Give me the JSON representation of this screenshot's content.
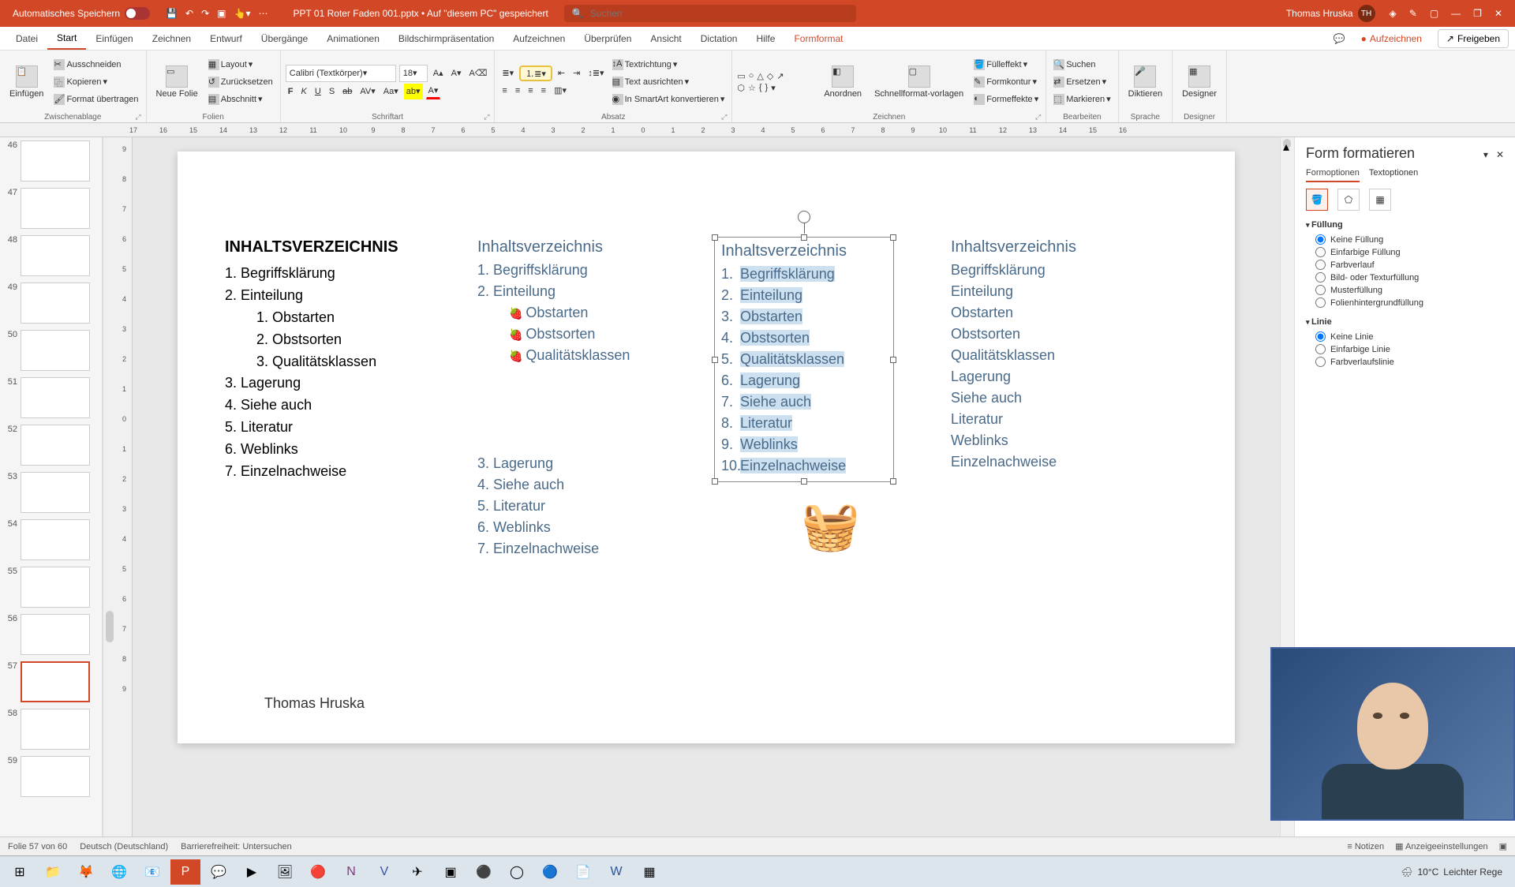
{
  "titlebar": {
    "autosave": "Automatisches Speichern",
    "filename": "PPT 01 Roter Faden 001.pptx • Auf \"diesem PC\" gespeichert",
    "search_placeholder": "Suchen",
    "user": "Thomas Hruska",
    "user_initials": "TH"
  },
  "tabs": [
    "Datei",
    "Start",
    "Einfügen",
    "Zeichnen",
    "Entwurf",
    "Übergänge",
    "Animationen",
    "Bildschirmpräsentation",
    "Aufzeichnen",
    "Überprüfen",
    "Ansicht",
    "Dictation",
    "Hilfe",
    "Formformat"
  ],
  "active_tab": "Start",
  "context_tab": "Formformat",
  "ribbon_right": {
    "record": "Aufzeichnen",
    "share": "Freigeben"
  },
  "ribbon": {
    "clipboard": {
      "paste": "Einfügen",
      "cut": "Ausschneiden",
      "copy": "Kopieren",
      "format": "Format übertragen",
      "label": "Zwischenablage"
    },
    "slides": {
      "new": "Neue Folie",
      "layout": "Layout",
      "reset": "Zurücksetzen",
      "section": "Abschnitt",
      "label": "Folien"
    },
    "font": {
      "name": "Calibri (Textkörper)",
      "size": "18",
      "label": "Schriftart"
    },
    "paragraph": {
      "textdir": "Textrichtung",
      "align": "Text ausrichten",
      "smartart": "In SmartArt konvertieren",
      "label": "Absatz"
    },
    "drawing": {
      "arrange": "Anordnen",
      "quick": "Schnellformat-vorlagen",
      "fill": "Fülleffekt",
      "outline": "Formkontur",
      "effects": "Formeffekte",
      "label": "Zeichnen"
    },
    "editing": {
      "find": "Suchen",
      "replace": "Ersetzen",
      "select": "Markieren",
      "label": "Bearbeiten"
    },
    "voice": {
      "dictate": "Diktieren",
      "label": "Sprache"
    },
    "designer": {
      "designer": "Designer",
      "label": "Designer"
    }
  },
  "ruler_h": [
    "17",
    "16",
    "15",
    "14",
    "13",
    "12",
    "11",
    "10",
    "9",
    "8",
    "7",
    "6",
    "5",
    "4",
    "3",
    "2",
    "1",
    "0",
    "1",
    "2",
    "3",
    "4",
    "5",
    "6",
    "7",
    "8",
    "9",
    "10",
    "11",
    "12",
    "13",
    "14",
    "15",
    "16"
  ],
  "ruler_v": [
    "9",
    "8",
    "7",
    "6",
    "5",
    "4",
    "3",
    "2",
    "1",
    "0",
    "1",
    "2",
    "3",
    "4",
    "5",
    "6",
    "7",
    "8",
    "9"
  ],
  "thumbs": [
    {
      "n": 46
    },
    {
      "n": 47
    },
    {
      "n": 48
    },
    {
      "n": 49
    },
    {
      "n": 50
    },
    {
      "n": 51
    },
    {
      "n": 52
    },
    {
      "n": 53
    },
    {
      "n": 54
    },
    {
      "n": 55
    },
    {
      "n": 56
    },
    {
      "n": 57,
      "active": true
    },
    {
      "n": 58
    },
    {
      "n": 59
    }
  ],
  "slide": {
    "toc1_title": "INHALTSVERZEICHNIS",
    "toc1": [
      {
        "t": "1.   Begriffsklärung",
        "lvl": 1
      },
      {
        "t": "2.   Einteilung",
        "lvl": 1
      },
      {
        "t": "1.   Obstarten",
        "lvl": 2
      },
      {
        "t": "2.   Obstsorten",
        "lvl": 2
      },
      {
        "t": "3.   Qualitätsklassen",
        "lvl": 2
      },
      {
        "t": "3.   Lagerung",
        "lvl": 1
      },
      {
        "t": "4.   Siehe auch",
        "lvl": 1
      },
      {
        "t": "5.   Literatur",
        "lvl": 1
      },
      {
        "t": "6.   Weblinks",
        "lvl": 1
      },
      {
        "t": "7.   Einzelnachweise",
        "lvl": 1
      }
    ],
    "toc2_title": "Inhaltsverzeichnis",
    "toc2_top": [
      {
        "t": "1.   Begriffsklärung"
      },
      {
        "t": "2.   Einteilung"
      }
    ],
    "toc2_bul": [
      "Obstarten",
      "Obstsorten",
      "Qualitätsklassen"
    ],
    "toc2_bot": [
      {
        "t": "3.   Lagerung"
      },
      {
        "t": "4.   Siehe auch"
      },
      {
        "t": "5.   Literatur"
      },
      {
        "t": "6.   Weblinks"
      },
      {
        "t": "7.   Einzelnachweise"
      }
    ],
    "toc3_title": "Inhaltsverzeichnis",
    "toc3": [
      {
        "n": "1.",
        "t": "Begriffsklärung"
      },
      {
        "n": "2.",
        "t": "Einteilung"
      },
      {
        "n": "3.",
        "t": "Obstarten"
      },
      {
        "n": "4.",
        "t": "Obstsorten"
      },
      {
        "n": "5.",
        "t": "Qualitätsklassen"
      },
      {
        "n": "6.",
        "t": "Lagerung"
      },
      {
        "n": "7.",
        "t": "Siehe auch"
      },
      {
        "n": "8.",
        "t": "Literatur"
      },
      {
        "n": "9.",
        "t": "Weblinks"
      },
      {
        "n": "10.",
        "t": "Einzelnachweise"
      }
    ],
    "toc4_title": "Inhaltsverzeichnis",
    "toc4": [
      "Begriffsklärung",
      "Einteilung",
      "Obstarten",
      "Obstsorten",
      "Qualitätsklassen",
      "Lagerung",
      "Siehe auch",
      "Literatur",
      "Weblinks",
      "Einzelnachweise"
    ],
    "footer": "Thomas Hruska"
  },
  "format_pane": {
    "title": "Form formatieren",
    "opt1": "Formoptionen",
    "opt2": "Textoptionen",
    "fill_title": "Füllung",
    "fill_opts": [
      "Keine Füllung",
      "Einfarbige Füllung",
      "Farbverlauf",
      "Bild- oder Texturfüllung",
      "Musterfüllung",
      "Folienhintergrundfüllung"
    ],
    "fill_checked": 0,
    "line_title": "Linie",
    "line_opts": [
      "Keine Linie",
      "Einfarbige Linie",
      "Farbverlaufslinie"
    ],
    "line_checked": 0
  },
  "statusbar": {
    "slide": "Folie 57 von 60",
    "lang": "Deutsch (Deutschland)",
    "access": "Barrierefreiheit: Untersuchen",
    "notes": "Notizen",
    "display": "Anzeigeeinstellungen"
  },
  "taskbar": {
    "weather_temp": "10°C",
    "weather_desc": "Leichter Rege"
  }
}
